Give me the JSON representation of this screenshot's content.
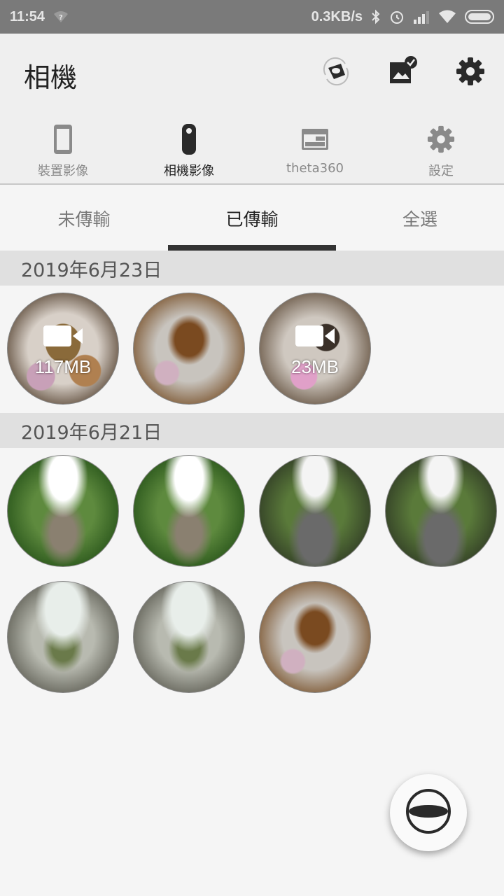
{
  "status_bar": {
    "time": "11:54",
    "network_speed": "0.3KB/s",
    "icons": [
      "wifi-question-icon",
      "bluetooth-icon",
      "alarm-icon",
      "signal-icon",
      "wifi-icon",
      "battery-icon"
    ]
  },
  "app_bar": {
    "title": "相機",
    "actions": [
      "rotate-camera-icon",
      "image-check-icon",
      "settings-icon"
    ]
  },
  "top_nav": {
    "items": [
      {
        "label": "裝置影像",
        "icon": "phone-icon"
      },
      {
        "label": "相機影像",
        "icon": "camera-device-icon"
      },
      {
        "label": "theta360",
        "icon": "browser-window-icon"
      },
      {
        "label": "設定",
        "icon": "settings-icon"
      }
    ],
    "active_index": 1
  },
  "tabs": {
    "items": [
      "未傳輸",
      "已傳輸",
      "全選"
    ],
    "active_index": 1
  },
  "sections": [
    {
      "date": "2019年6月23日",
      "items": [
        {
          "type": "video",
          "size": "117MB",
          "scene": "indoor"
        },
        {
          "type": "photo",
          "scene": "room"
        },
        {
          "type": "video",
          "size": "23MB",
          "scene": "person"
        }
      ]
    },
    {
      "date": "2019年6月21日",
      "items": [
        {
          "type": "photo",
          "scene": "garden"
        },
        {
          "type": "photo",
          "scene": "garden"
        },
        {
          "type": "photo",
          "scene": "yard"
        },
        {
          "type": "photo",
          "scene": "yard"
        },
        {
          "type": "photo",
          "scene": "greenhouse"
        },
        {
          "type": "photo",
          "scene": "greenhouse"
        },
        {
          "type": "photo",
          "scene": "room"
        }
      ]
    }
  ],
  "fab": {
    "icon": "shutter-icon"
  },
  "colors": {
    "status_bar": "#7a7a7a",
    "app_bar": "#efefef",
    "date_header": "#e0e0e0",
    "active_indicator": "#333333",
    "icon_dark": "#2a2a2a",
    "icon_muted": "#8a8a8a"
  }
}
